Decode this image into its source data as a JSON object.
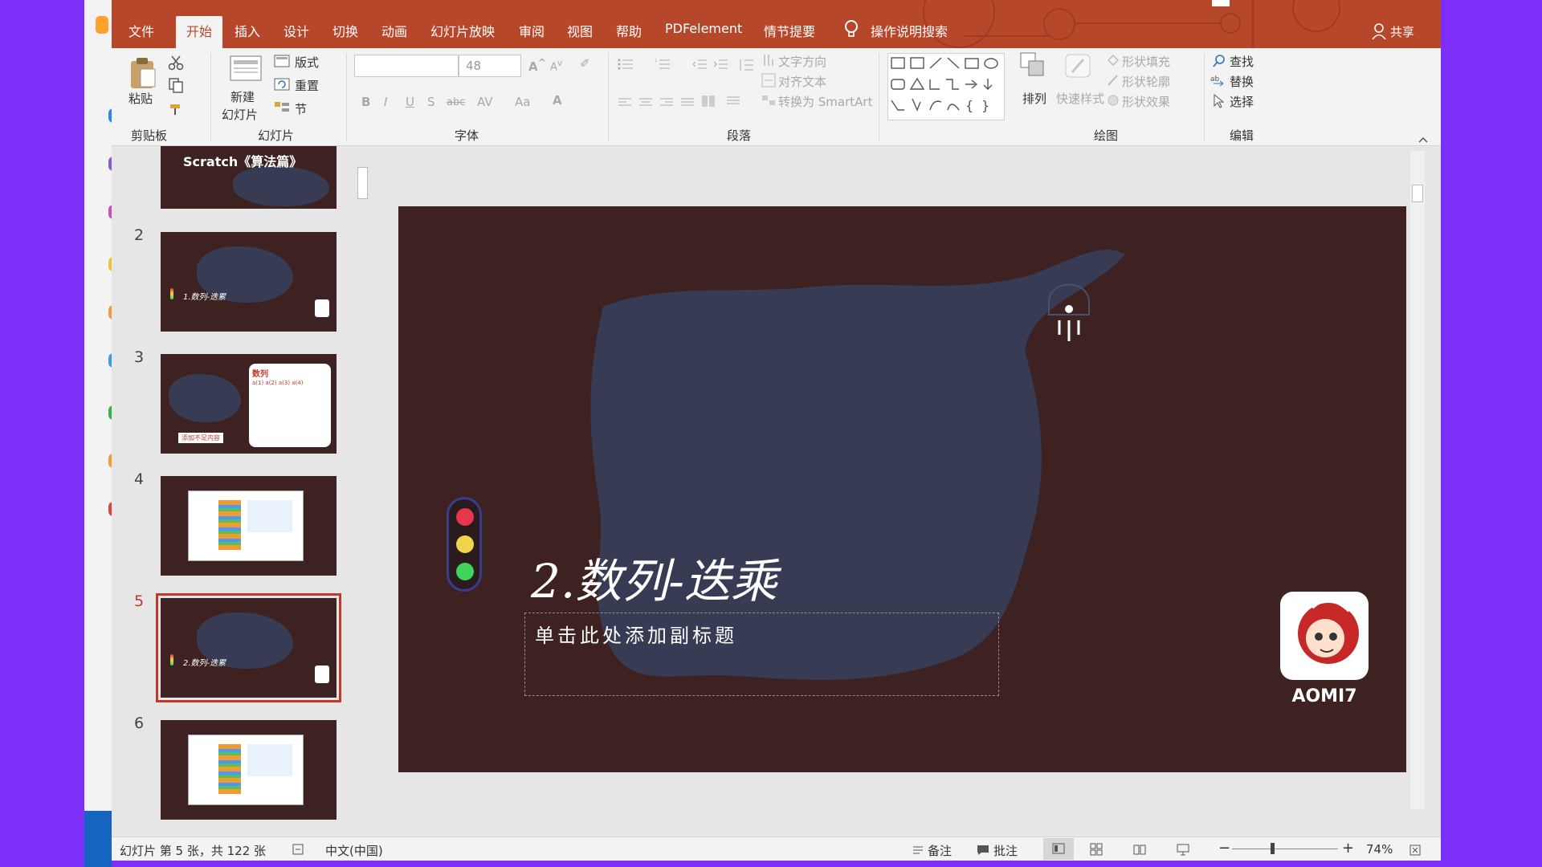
{
  "ribbon_tabs": [
    "文件",
    "开始",
    "插入",
    "设计",
    "切换",
    "动画",
    "幻灯片放映",
    "审阅",
    "视图",
    "帮助",
    "PDFelement",
    "情节提要"
  ],
  "search_hint": "操作说明搜索",
  "share_label": "共享",
  "clipboard": {
    "paste": "粘贴",
    "group_label": "剪贴板"
  },
  "slides_group": {
    "new_slide_line1": "新建",
    "new_slide_line2": "幻灯片",
    "layout": "版式",
    "reset": "重置",
    "section": "节",
    "group_label": "幻灯片"
  },
  "font_group": {
    "font_size": "48",
    "group_label": "字体"
  },
  "paragraph_group": {
    "text_direction": "文字方向",
    "align_text": "对齐文本",
    "smartart": "转换为 SmartArt",
    "group_label": "段落"
  },
  "drawing_group": {
    "arrange": "排列",
    "quick_styles": "快速样式",
    "shape_fill": "形状填充",
    "shape_outline": "形状轮廓",
    "shape_effects": "形状效果",
    "group_label": "绘图"
  },
  "editing_group": {
    "find": "查找",
    "replace": "替换",
    "select": "选择",
    "group_label": "编辑"
  },
  "thumbnails": [
    {
      "number": "",
      "title": "Scratch《算法篇》"
    },
    {
      "number": "2",
      "title": "1.数列-迭累"
    },
    {
      "number": "3",
      "title": "数列",
      "badge": "添加不足内容"
    },
    {
      "number": "4",
      "title": ""
    },
    {
      "number": "5",
      "title": "2.数列-迭累"
    },
    {
      "number": "6",
      "title": ""
    }
  ],
  "slide": {
    "title": "2.数列-迭乘",
    "subtitle_placeholder": "单击此处添加副标题",
    "logo_text": "AOMI7",
    "light_colors": [
      "#e8364c",
      "#f1d44b",
      "#3fd35a"
    ]
  },
  "status": {
    "slide_info": "幻灯片 第 5 张，共 122 张",
    "language": "中文(中国)",
    "notes": "备注",
    "comments": "批注",
    "zoom": "74%"
  },
  "colors": {
    "accent": "#b7472a",
    "slide_bg": "#3d2221",
    "brush": "#373b53"
  }
}
